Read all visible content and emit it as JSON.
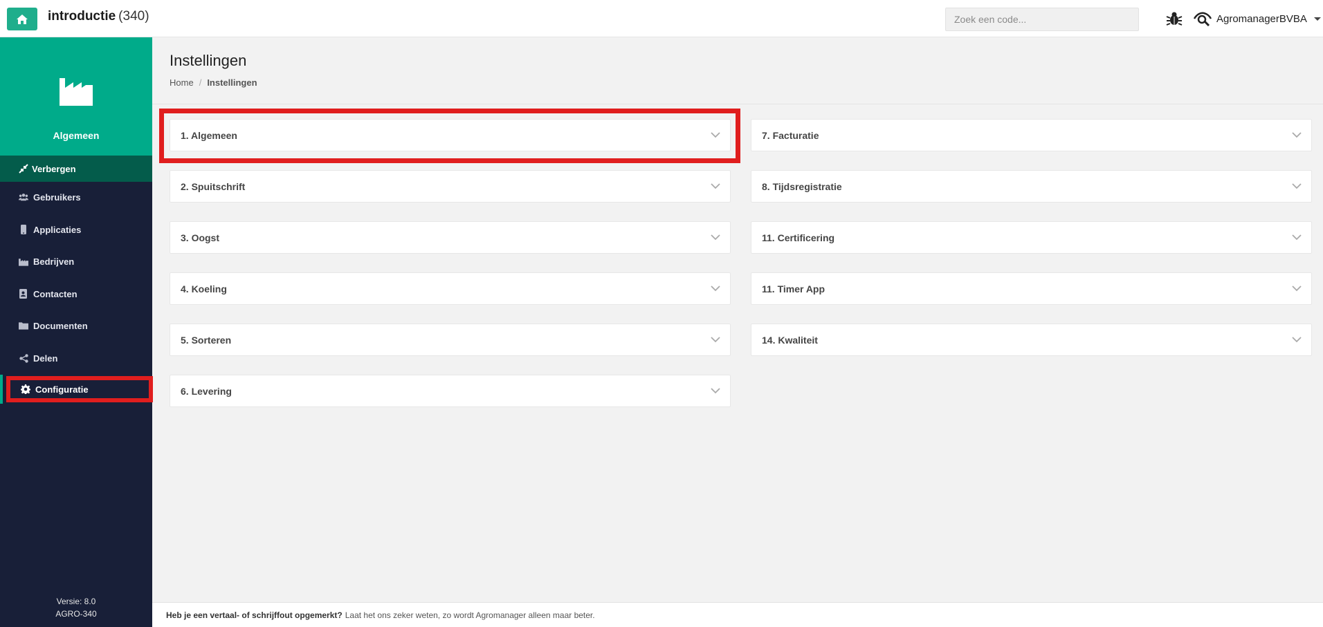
{
  "topbar": {
    "title": "introductie",
    "count": "(340)",
    "search_placeholder": "Zoek een code...",
    "user_name": "AgromanagerBVBA"
  },
  "sidebar": {
    "header_label": "Algemeen",
    "hide_label": "Verbergen",
    "items": [
      {
        "label": "Gebruikers",
        "icon": "users-icon"
      },
      {
        "label": "Applicaties",
        "icon": "mobile-icon"
      },
      {
        "label": "Bedrijven",
        "icon": "industry-icon"
      },
      {
        "label": "Contacten",
        "icon": "address-book-icon"
      },
      {
        "label": "Documenten",
        "icon": "folder-icon"
      },
      {
        "label": "Delen",
        "icon": "share-icon"
      },
      {
        "label": "Configuratie",
        "icon": "gear-icon"
      }
    ],
    "version_line1": "Versie: 8.0",
    "version_line2": "AGRO-340"
  },
  "page": {
    "title": "Instellingen",
    "breadcrumb_home": "Home",
    "breadcrumb_current": "Instellingen",
    "sep": "/"
  },
  "panels_left": [
    "1. Algemeen",
    "2. Spuitschrift",
    "3. Oogst",
    "4. Koeling",
    "5. Sorteren",
    "6. Levering"
  ],
  "panels_right": [
    "7. Facturatie",
    "8. Tijdsregistratie",
    "11. Certificering",
    "11. Timer App",
    "14. Kwaliteit"
  ],
  "footer": {
    "bold": "Heb je een vertaal- of schrijffout opgemerkt?",
    "text": "Laat het ons zeker weten, zo wordt Agromanager alleen maar beter."
  },
  "colors": {
    "accent": "#00ab8a",
    "sidebar_bg": "#181f38",
    "highlight": "#e01e1e"
  }
}
